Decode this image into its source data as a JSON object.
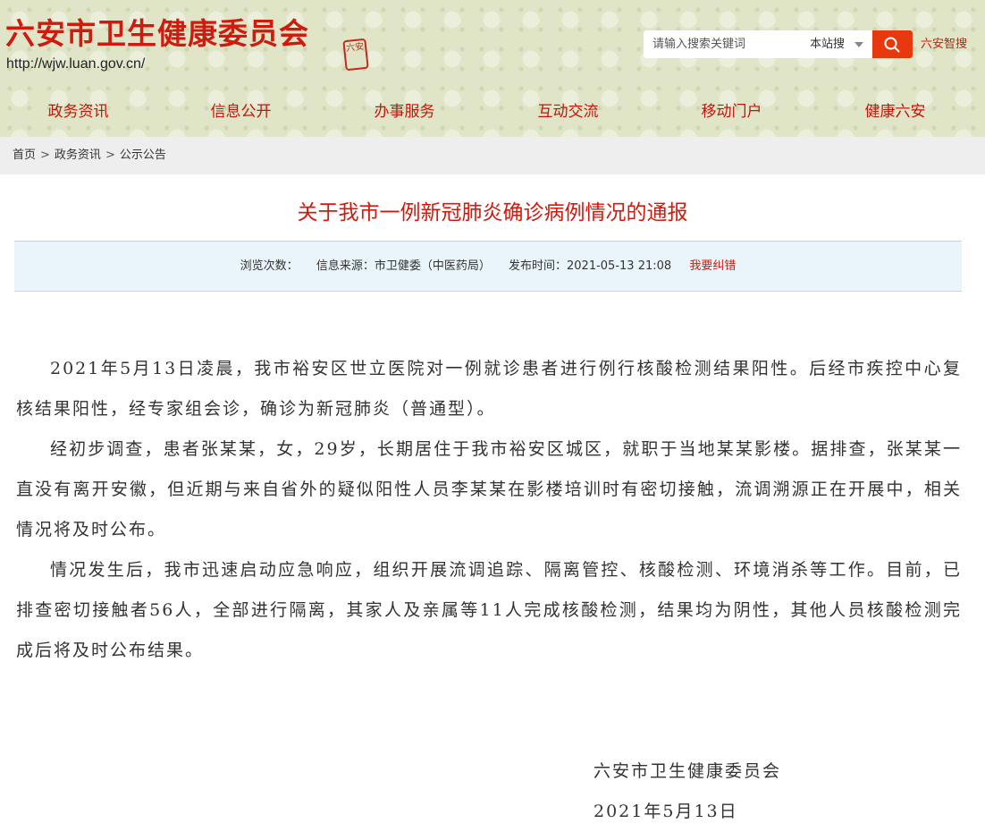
{
  "site": {
    "title": "六安市卫生健康委员会",
    "url": "http://wjw.luan.gov.cn/",
    "seal_text": "六安"
  },
  "search": {
    "placeholder": "请输入搜索关键词",
    "scope": "本站搜",
    "smart_search": "六安智搜"
  },
  "nav": {
    "items": [
      "政务资讯",
      "信息公开",
      "办事服务",
      "互动交流",
      "移动门户",
      "健康六安"
    ]
  },
  "breadcrumb": {
    "items": [
      "首页",
      "政务资讯",
      "公示公告"
    ],
    "separator": ">"
  },
  "article": {
    "title": "关于我市一例新冠肺炎确诊病例情况的通报",
    "meta": {
      "views_label": "浏览次数：",
      "source_label": "信息来源：",
      "source_value": "市卫健委（中医药局）",
      "publish_label": "发布时间：",
      "publish_value": "2021-05-13 21:08",
      "correct_link": "我要纠错"
    },
    "paragraphs": [
      "2021年5月13日凌晨，我市裕安区世立医院对一例就诊患者进行例行核酸检测结果阳性。后经市疾控中心复核结果阳性，经专家组会诊，确诊为新冠肺炎（普通型）。",
      "经初步调查，患者张某某，女，29岁，长期居住于我市裕安区城区，就职于当地某某影楼。据排查，张某某一直没有离开安徽，但近期与来自省外的疑似阳性人员李某某在影楼培训时有密切接触，流调溯源正在开展中，相关情况将及时公布。",
      "情况发生后，我市迅速启动应急响应，组织开展流调追踪、隔离管控、核酸检测、环境消杀等工作。目前，已排查密切接触者56人，全部进行隔离，其家人及亲属等11人完成核酸检测，结果均为阴性，其他人员核酸检测完成后将及时公布结果。"
    ],
    "signature": {
      "org": "六安市卫生健康委员会",
      "date": "2021年5月13日"
    }
  },
  "colors": {
    "brand_red": "#d11a0e",
    "search_button": "#e8390e",
    "header_bg": "#dfe5c6",
    "meta_bg": "#e9f5fa"
  }
}
